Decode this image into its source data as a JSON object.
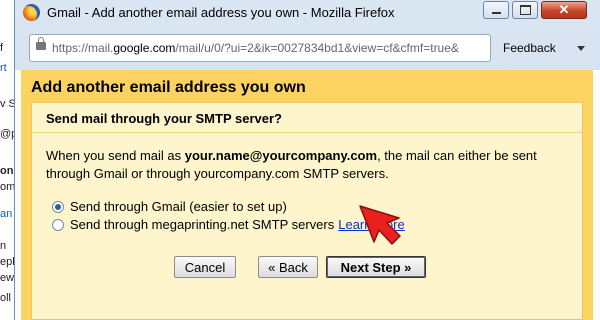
{
  "background_page": {
    "fragments": [
      "f",
      "rt",
      "v S",
      "@p",
      "oni",
      "om",
      "an",
      "n",
      "epl",
      "ew",
      "oll"
    ]
  },
  "window": {
    "title": "Gmail - Add another email address you own - Mozilla Firefox",
    "url_prefix": "https://mail.",
    "url_host": "google.com",
    "url_rest": "/mail/u/0/?ui=2&ik=0027834bd1&view=cf&cfmf=true&",
    "feedback_label": "Feedback"
  },
  "dialog": {
    "title": "Add another email address you own",
    "subtitle": "Send mail through your SMTP server?",
    "desc_part1": "When you send mail as ",
    "desc_email": "your.name@yourcompany.com",
    "desc_part2": ", the mail can either be sent through Gmail or through yourcompany.com SMTP servers.",
    "option_gmail": "Send through Gmail (easier to set up)",
    "option_smtp": "Send through megaprinting.net SMTP servers",
    "learn_more": "Learn more",
    "cancel_label": "Cancel",
    "back_label": "« Back",
    "next_label": "Next Step »",
    "selected_option": "gmail"
  },
  "colors": {
    "dialog_bg": "#fcd361",
    "panel_bg": "#fff5cc",
    "link": "#0033cc",
    "cursor": "#e8201e"
  },
  "icons": [
    "firefox-icon",
    "minimize-icon",
    "maximize-icon",
    "close-icon",
    "lock-icon",
    "chevron-down-icon",
    "radio-icon",
    "cursor-arrow-icon"
  ]
}
